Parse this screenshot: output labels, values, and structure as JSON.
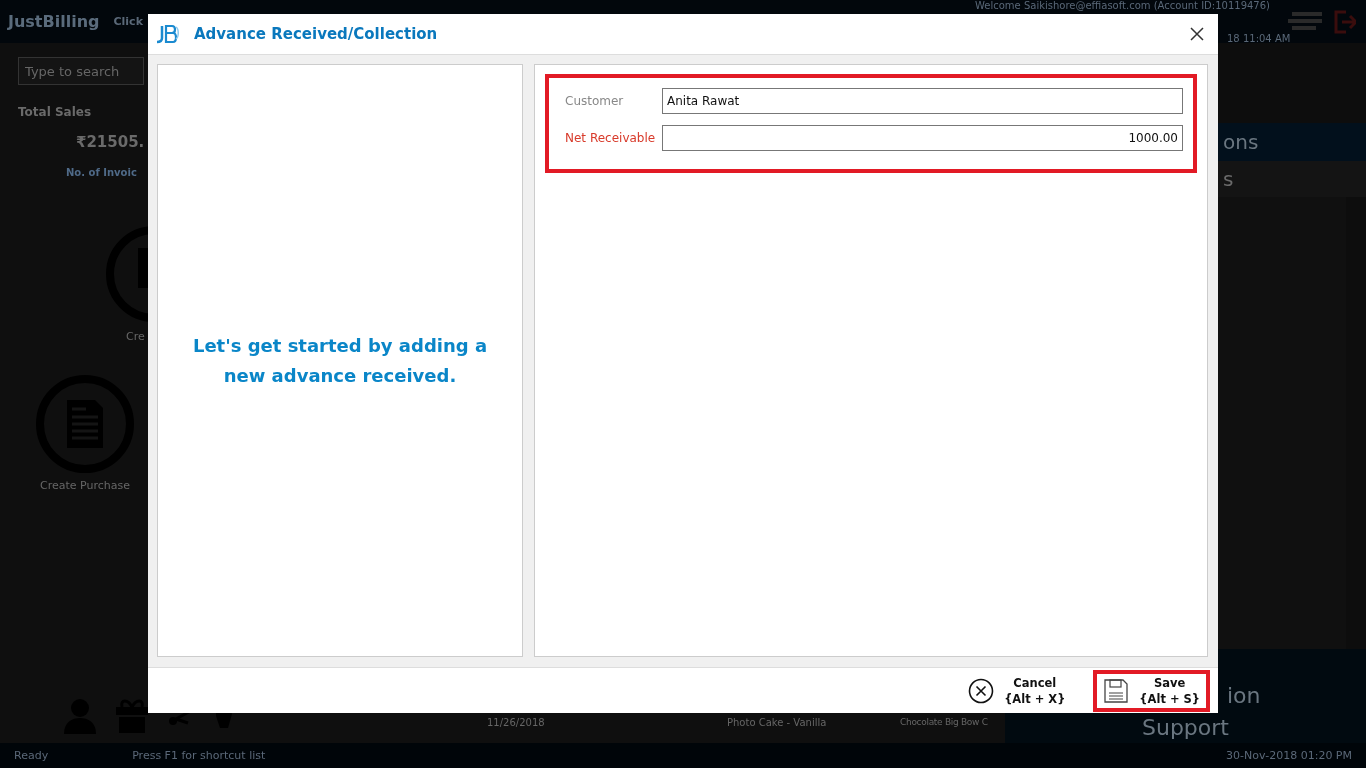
{
  "background": {
    "app_name": "JustBilling",
    "header_hint": "Click",
    "welcome": "Welcome Saikishore@effiasoft.com (Account ID:10119476)",
    "login_time": "18 11:04 AM",
    "search": {
      "placeholder": "Type to search"
    },
    "total_sales_label": "Total Sales",
    "total_sales_value": "₹21505.",
    "invoices_label": "No. of Invoic",
    "tiles": [
      {
        "label": "Cre"
      },
      {
        "label": "Create Purchase"
      }
    ],
    "recent_row": [
      "11/26/2018",
      "Photo Cake - Vanilla",
      "Chocolate Big Bow C"
    ],
    "right_panel": {
      "heading": "ons",
      "subheading": "s",
      "menu": [
        "ion",
        "Support"
      ]
    },
    "status_bar": {
      "status": "Ready",
      "hint": "Press F1 for shortcut list",
      "datetime": "30-Nov-2018 01:20 PM"
    }
  },
  "dialog": {
    "title": "Advance Received/Collection",
    "empty_message": "Let's get started by adding a new advance received.",
    "fields_highlighted": true,
    "fields": [
      {
        "label": "Customer",
        "value": "Anita Rawat",
        "required": false,
        "kind": "text"
      },
      {
        "label": "Net Receivable",
        "value": "1000.00",
        "required": true,
        "kind": "amount"
      }
    ],
    "buttons": [
      {
        "kind": "cancel",
        "label": "Cancel",
        "shortcut": "{Alt + X}",
        "highlighted": false
      },
      {
        "kind": "save",
        "label": "Save",
        "shortcut": "{Alt + S}",
        "highlighted": true
      }
    ]
  }
}
